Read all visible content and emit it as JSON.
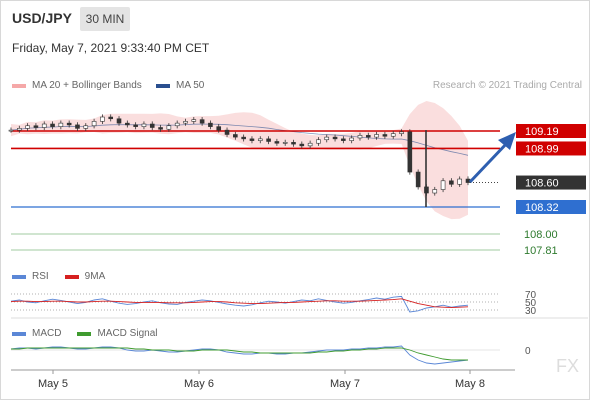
{
  "header": {
    "symbol": "USD/JPY",
    "timeframe": "30 MIN",
    "datetime": "Friday, May 7, 2021 9:33:40 PM CET"
  },
  "legend_main": {
    "bollinger": "MA 20 + Bollinger Bands",
    "ma50": "MA 50",
    "copyright": "Research © 2021 Trading Central"
  },
  "legend_rsi": {
    "rsi": "RSI",
    "ma9": "9MA"
  },
  "legend_macd": {
    "macd": "MACD",
    "signal": "MACD Signal"
  },
  "watermark": "FX",
  "colors": {
    "resistance": "#d00000",
    "support": "#2f6fd0",
    "target": "#2e8b2e",
    "current": "#333333",
    "bollinger": "#f5b5b5",
    "ma50": "#2a4f8f",
    "arrow": "#2e5fb0",
    "rsi": "#5b87d6",
    "ma9": "#d62020",
    "macd": "#5b87d6",
    "macd_signal": "#3f9b2f"
  },
  "chart_data": {
    "type": "line",
    "x_labels": [
      "May 5",
      "May 6",
      "May 7",
      "May 8"
    ],
    "price_levels": [
      {
        "label": "109.19",
        "value": 109.19,
        "kind": "resistance"
      },
      {
        "label": "108.99",
        "value": 108.99,
        "kind": "resistance"
      },
      {
        "label": "108.60",
        "value": 108.6,
        "kind": "current"
      },
      {
        "label": "108.32",
        "value": 108.32,
        "kind": "support"
      },
      {
        "label": "108.00",
        "value": 108.0,
        "kind": "target"
      },
      {
        "label": "107.81",
        "value": 107.81,
        "kind": "target"
      }
    ],
    "price_series": [
      109.2,
      109.22,
      109.25,
      109.23,
      109.27,
      109.24,
      109.28,
      109.26,
      109.22,
      109.25,
      109.3,
      109.35,
      109.33,
      109.28,
      109.26,
      109.24,
      109.27,
      109.23,
      109.21,
      109.25,
      109.28,
      109.3,
      109.32,
      109.28,
      109.24,
      109.2,
      109.15,
      109.12,
      109.1,
      109.08,
      109.1,
      109.07,
      109.05,
      109.06,
      109.04,
      109.02,
      109.05,
      109.09,
      109.12,
      109.1,
      109.08,
      109.11,
      109.14,
      109.12,
      109.15,
      109.13,
      109.16,
      109.18,
      108.72,
      108.55,
      108.48,
      108.52,
      108.62,
      108.58,
      108.64,
      108.6
    ],
    "rsi": {
      "levels": [
        70,
        50,
        30
      ],
      "rsi_series": [
        52,
        55,
        50,
        48,
        53,
        57,
        54,
        50,
        46,
        49,
        55,
        58,
        52,
        47,
        44,
        46,
        50,
        53,
        48,
        45,
        44,
        49,
        52,
        55,
        53,
        49,
        45,
        42,
        40,
        43,
        48,
        52,
        50,
        47,
        51,
        55,
        53,
        58,
        54,
        50,
        47,
        49,
        53,
        56,
        60,
        57,
        62,
        64,
        25,
        28,
        35,
        38,
        42,
        37,
        40,
        42
      ],
      "ma9_series": [
        51,
        52,
        52,
        51,
        51,
        52,
        52,
        51,
        50,
        50,
        51,
        52,
        52,
        51,
        50,
        49,
        49,
        49,
        49,
        48,
        48,
        48,
        49,
        50,
        51,
        51,
        50,
        48,
        47,
        46,
        46,
        47,
        48,
        49,
        49,
        50,
        51,
        52,
        53,
        53,
        52,
        52,
        52,
        53,
        54,
        55,
        56,
        58,
        52,
        46,
        42,
        38,
        37,
        36,
        37,
        38
      ]
    },
    "macd": {
      "zero_label": "0",
      "macd_series": [
        0.01,
        0.02,
        0.02,
        0.01,
        0.02,
        0.03,
        0.03,
        0.02,
        0.01,
        0.01,
        0.02,
        0.03,
        0.03,
        0.02,
        0.0,
        -0.01,
        -0.01,
        0.0,
        -0.01,
        -0.02,
        -0.02,
        -0.01,
        0.0,
        0.01,
        0.01,
        0.0,
        -0.02,
        -0.03,
        -0.04,
        -0.04,
        -0.03,
        -0.03,
        -0.04,
        -0.04,
        -0.03,
        -0.03,
        -0.02,
        -0.01,
        0.0,
        0.0,
        0.0,
        0.01,
        0.01,
        0.02,
        0.02,
        0.03,
        0.03,
        0.04,
        -0.05,
        -0.1,
        -0.13,
        -0.14,
        -0.13,
        -0.12,
        -0.11,
        -0.1
      ],
      "signal_series": [
        0.01,
        0.01,
        0.02,
        0.02,
        0.02,
        0.02,
        0.02,
        0.02,
        0.02,
        0.02,
        0.02,
        0.02,
        0.02,
        0.02,
        0.02,
        0.01,
        0.01,
        0.0,
        0.0,
        0.0,
        -0.01,
        -0.01,
        -0.01,
        0.0,
        0.0,
        0.0,
        0.0,
        -0.01,
        -0.02,
        -0.02,
        -0.03,
        -0.03,
        -0.03,
        -0.03,
        -0.03,
        -0.03,
        -0.03,
        -0.02,
        -0.02,
        -0.01,
        -0.01,
        0.0,
        0.0,
        0.01,
        0.01,
        0.02,
        0.02,
        0.02,
        0.0,
        -0.03,
        -0.05,
        -0.07,
        -0.09,
        -0.1,
        -0.1,
        -0.1
      ]
    }
  }
}
